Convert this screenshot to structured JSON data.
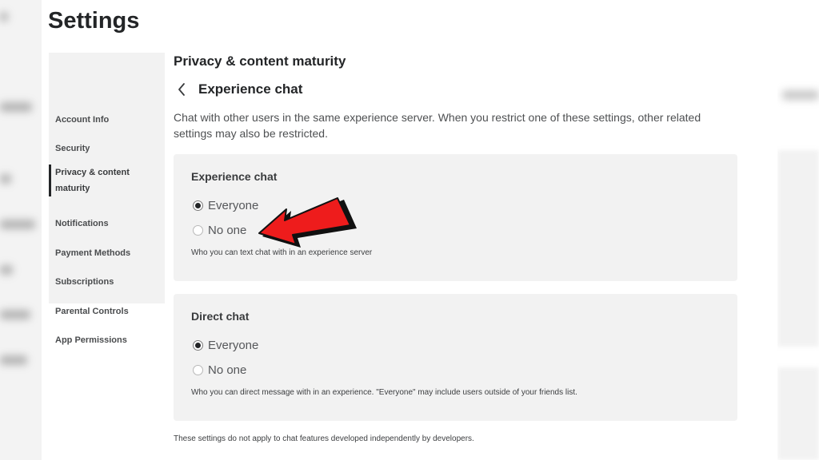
{
  "page": {
    "title": "Settings"
  },
  "sidebar": {
    "items": [
      {
        "label": "Account Info"
      },
      {
        "label": "Security"
      },
      {
        "label": "Privacy & content maturity"
      },
      {
        "label": "Notifications"
      },
      {
        "label": "Payment Methods"
      },
      {
        "label": "Subscriptions"
      },
      {
        "label": "Parental Controls"
      },
      {
        "label": "App Permissions"
      }
    ],
    "active_item": "Privacy & content maturity"
  },
  "main": {
    "section_title": "Privacy & content maturity",
    "subpage_title": "Experience chat",
    "description": "Chat with other users in the same experience server. When you restrict one of these settings, other related settings may also be restricted.",
    "experience_chat": {
      "title": "Experience chat",
      "options": [
        "Everyone",
        "No one"
      ],
      "selected": "Everyone",
      "help": "Who you can text chat with in an experience server"
    },
    "direct_chat": {
      "title": "Direct chat",
      "options": [
        "Everyone",
        "No one"
      ],
      "selected": "Everyone",
      "help": "Who you can direct message with in an experience. \"Everyone\" may include users outside of your friends list."
    },
    "footer_note": "These settings do not apply to chat features developed independently by developers."
  },
  "annotation": {
    "arrow_color": "#ee1c1c",
    "arrow_target": "No one"
  },
  "colors": {
    "card_bg": "#f2f2f2",
    "text_dark": "#232527"
  },
  "icons": {
    "back": "chevron-left-icon"
  }
}
